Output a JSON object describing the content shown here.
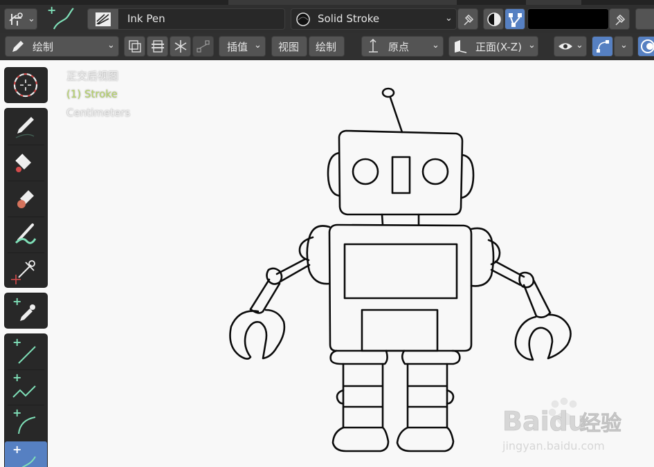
{
  "header": {
    "brush_name": "Ink Pen",
    "material_name": "Solid Stroke",
    "color_swatch": "#000000"
  },
  "toolbar_row": {
    "mode_label": "绘制",
    "interp_label": "插值",
    "view_label": "视图",
    "draw_label": "绘制",
    "origin_label": "原点",
    "plane_label": "正面(X-Z)"
  },
  "overlay": {
    "view_name": "正交后视图",
    "object_name": "(1) Stroke",
    "units": "Centimeters"
  },
  "tools": [
    "cursor-icon",
    "draw-icon",
    "fill-icon",
    "erase-icon",
    "tint-icon",
    "cutter-icon",
    "eyedropper-icon",
    "line-icon",
    "polyline-icon",
    "arc-icon",
    "curve-icon"
  ],
  "watermark": {
    "brand": "Baidu",
    "suffix": "经验",
    "url": "jingyan.baidu.com"
  },
  "colors": {
    "accent": "#5680c2",
    "overlay_green": "#b6d36a",
    "overlay_white": "#f0f0f0",
    "tool_green": "#7fe0b8"
  }
}
